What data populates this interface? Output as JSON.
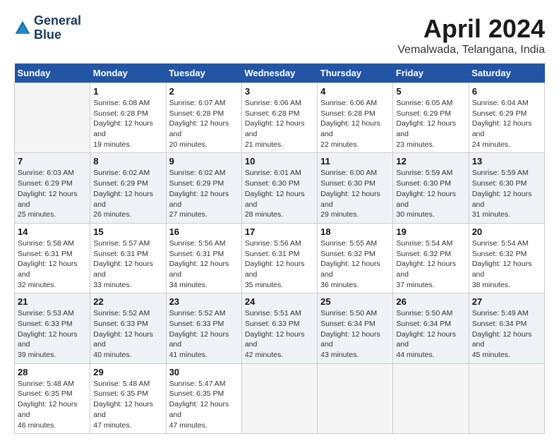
{
  "header": {
    "logo": {
      "line1": "General",
      "line2": "Blue"
    },
    "title": "April 2024",
    "location": "Vemalwada, Telangana, India"
  },
  "calendar": {
    "days_of_week": [
      "Sunday",
      "Monday",
      "Tuesday",
      "Wednesday",
      "Thursday",
      "Friday",
      "Saturday"
    ],
    "weeks": [
      [
        {
          "day": "",
          "sunrise": "",
          "sunset": "",
          "daylight": ""
        },
        {
          "day": "1",
          "sunrise": "Sunrise: 6:08 AM",
          "sunset": "Sunset: 6:28 PM",
          "daylight": "Daylight: 12 hours and 19 minutes."
        },
        {
          "day": "2",
          "sunrise": "Sunrise: 6:07 AM",
          "sunset": "Sunset: 6:28 PM",
          "daylight": "Daylight: 12 hours and 20 minutes."
        },
        {
          "day": "3",
          "sunrise": "Sunrise: 6:06 AM",
          "sunset": "Sunset: 6:28 PM",
          "daylight": "Daylight: 12 hours and 21 minutes."
        },
        {
          "day": "4",
          "sunrise": "Sunrise: 6:06 AM",
          "sunset": "Sunset: 6:28 PM",
          "daylight": "Daylight: 12 hours and 22 minutes."
        },
        {
          "day": "5",
          "sunrise": "Sunrise: 6:05 AM",
          "sunset": "Sunset: 6:29 PM",
          "daylight": "Daylight: 12 hours and 23 minutes."
        },
        {
          "day": "6",
          "sunrise": "Sunrise: 6:04 AM",
          "sunset": "Sunset: 6:29 PM",
          "daylight": "Daylight: 12 hours and 24 minutes."
        }
      ],
      [
        {
          "day": "7",
          "sunrise": "Sunrise: 6:03 AM",
          "sunset": "Sunset: 6:29 PM",
          "daylight": "Daylight: 12 hours and 25 minutes."
        },
        {
          "day": "8",
          "sunrise": "Sunrise: 6:02 AM",
          "sunset": "Sunset: 6:29 PM",
          "daylight": "Daylight: 12 hours and 26 minutes."
        },
        {
          "day": "9",
          "sunrise": "Sunrise: 6:02 AM",
          "sunset": "Sunset: 6:29 PM",
          "daylight": "Daylight: 12 hours and 27 minutes."
        },
        {
          "day": "10",
          "sunrise": "Sunrise: 6:01 AM",
          "sunset": "Sunset: 6:30 PM",
          "daylight": "Daylight: 12 hours and 28 minutes."
        },
        {
          "day": "11",
          "sunrise": "Sunrise: 6:00 AM",
          "sunset": "Sunset: 6:30 PM",
          "daylight": "Daylight: 12 hours and 29 minutes."
        },
        {
          "day": "12",
          "sunrise": "Sunrise: 5:59 AM",
          "sunset": "Sunset: 6:30 PM",
          "daylight": "Daylight: 12 hours and 30 minutes."
        },
        {
          "day": "13",
          "sunrise": "Sunrise: 5:59 AM",
          "sunset": "Sunset: 6:30 PM",
          "daylight": "Daylight: 12 hours and 31 minutes."
        }
      ],
      [
        {
          "day": "14",
          "sunrise": "Sunrise: 5:58 AM",
          "sunset": "Sunset: 6:31 PM",
          "daylight": "Daylight: 12 hours and 32 minutes."
        },
        {
          "day": "15",
          "sunrise": "Sunrise: 5:57 AM",
          "sunset": "Sunset: 6:31 PM",
          "daylight": "Daylight: 12 hours and 33 minutes."
        },
        {
          "day": "16",
          "sunrise": "Sunrise: 5:56 AM",
          "sunset": "Sunset: 6:31 PM",
          "daylight": "Daylight: 12 hours and 34 minutes."
        },
        {
          "day": "17",
          "sunrise": "Sunrise: 5:56 AM",
          "sunset": "Sunset: 6:31 PM",
          "daylight": "Daylight: 12 hours and 35 minutes."
        },
        {
          "day": "18",
          "sunrise": "Sunrise: 5:55 AM",
          "sunset": "Sunset: 6:32 PM",
          "daylight": "Daylight: 12 hours and 36 minutes."
        },
        {
          "day": "19",
          "sunrise": "Sunrise: 5:54 AM",
          "sunset": "Sunset: 6:32 PM",
          "daylight": "Daylight: 12 hours and 37 minutes."
        },
        {
          "day": "20",
          "sunrise": "Sunrise: 5:54 AM",
          "sunset": "Sunset: 6:32 PM",
          "daylight": "Daylight: 12 hours and 38 minutes."
        }
      ],
      [
        {
          "day": "21",
          "sunrise": "Sunrise: 5:53 AM",
          "sunset": "Sunset: 6:33 PM",
          "daylight": "Daylight: 12 hours and 39 minutes."
        },
        {
          "day": "22",
          "sunrise": "Sunrise: 5:52 AM",
          "sunset": "Sunset: 6:33 PM",
          "daylight": "Daylight: 12 hours and 40 minutes."
        },
        {
          "day": "23",
          "sunrise": "Sunrise: 5:52 AM",
          "sunset": "Sunset: 6:33 PM",
          "daylight": "Daylight: 12 hours and 41 minutes."
        },
        {
          "day": "24",
          "sunrise": "Sunrise: 5:51 AM",
          "sunset": "Sunset: 6:33 PM",
          "daylight": "Daylight: 12 hours and 42 minutes."
        },
        {
          "day": "25",
          "sunrise": "Sunrise: 5:50 AM",
          "sunset": "Sunset: 6:34 PM",
          "daylight": "Daylight: 12 hours and 43 minutes."
        },
        {
          "day": "26",
          "sunrise": "Sunrise: 5:50 AM",
          "sunset": "Sunset: 6:34 PM",
          "daylight": "Daylight: 12 hours and 44 minutes."
        },
        {
          "day": "27",
          "sunrise": "Sunrise: 5:49 AM",
          "sunset": "Sunset: 6:34 PM",
          "daylight": "Daylight: 12 hours and 45 minutes."
        }
      ],
      [
        {
          "day": "28",
          "sunrise": "Sunrise: 5:48 AM",
          "sunset": "Sunset: 6:35 PM",
          "daylight": "Daylight: 12 hours and 46 minutes."
        },
        {
          "day": "29",
          "sunrise": "Sunrise: 5:48 AM",
          "sunset": "Sunset: 6:35 PM",
          "daylight": "Daylight: 12 hours and 47 minutes."
        },
        {
          "day": "30",
          "sunrise": "Sunrise: 5:47 AM",
          "sunset": "Sunset: 6:35 PM",
          "daylight": "Daylight: 12 hours and 47 minutes."
        },
        {
          "day": "",
          "sunrise": "",
          "sunset": "",
          "daylight": ""
        },
        {
          "day": "",
          "sunrise": "",
          "sunset": "",
          "daylight": ""
        },
        {
          "day": "",
          "sunrise": "",
          "sunset": "",
          "daylight": ""
        },
        {
          "day": "",
          "sunrise": "",
          "sunset": "",
          "daylight": ""
        }
      ]
    ]
  }
}
